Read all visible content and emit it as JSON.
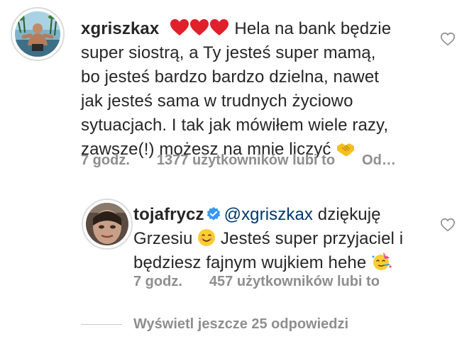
{
  "comments": [
    {
      "username": "xgriszkax",
      "hearts": "❤❤❤",
      "text_lines": [
        " Hela na bank będzie",
        "super siostrą, a Ty jesteś super mamą,",
        "bo jesteś bardzo bardzo dzielna, nawet",
        "jak jesteś sama w trudnych życiowo",
        "sytuacjach. I tak jak mówiłem wiele razy,",
        "zawsze(!) możesz na mnie liczyć "
      ],
      "end_emoji": "🤝",
      "time": "7 godz.",
      "likes": "1377 użytkowników lubi to",
      "reply": "Od…"
    },
    {
      "username": "tojafrycz",
      "verified": true,
      "mention": "@xgriszkax",
      "text_lines": [
        " dziękuję",
        "Grzesiu ",
        " Jesteś super przyjaciel i",
        "będziesz fajnym wujkiem hehe "
      ],
      "emoji_smile": "😊",
      "emoji_party": "🥳",
      "time": "7 godz.",
      "likes": "457 użytkowników lubi to"
    }
  ],
  "view_more": "Wyświetl jeszcze 25 odpowiedzi",
  "colors": {
    "text": "#262626",
    "muted": "#8e8e8e",
    "mention": "#00376b",
    "heart_red": "#e0202a",
    "verified_blue": "#3897f0"
  }
}
